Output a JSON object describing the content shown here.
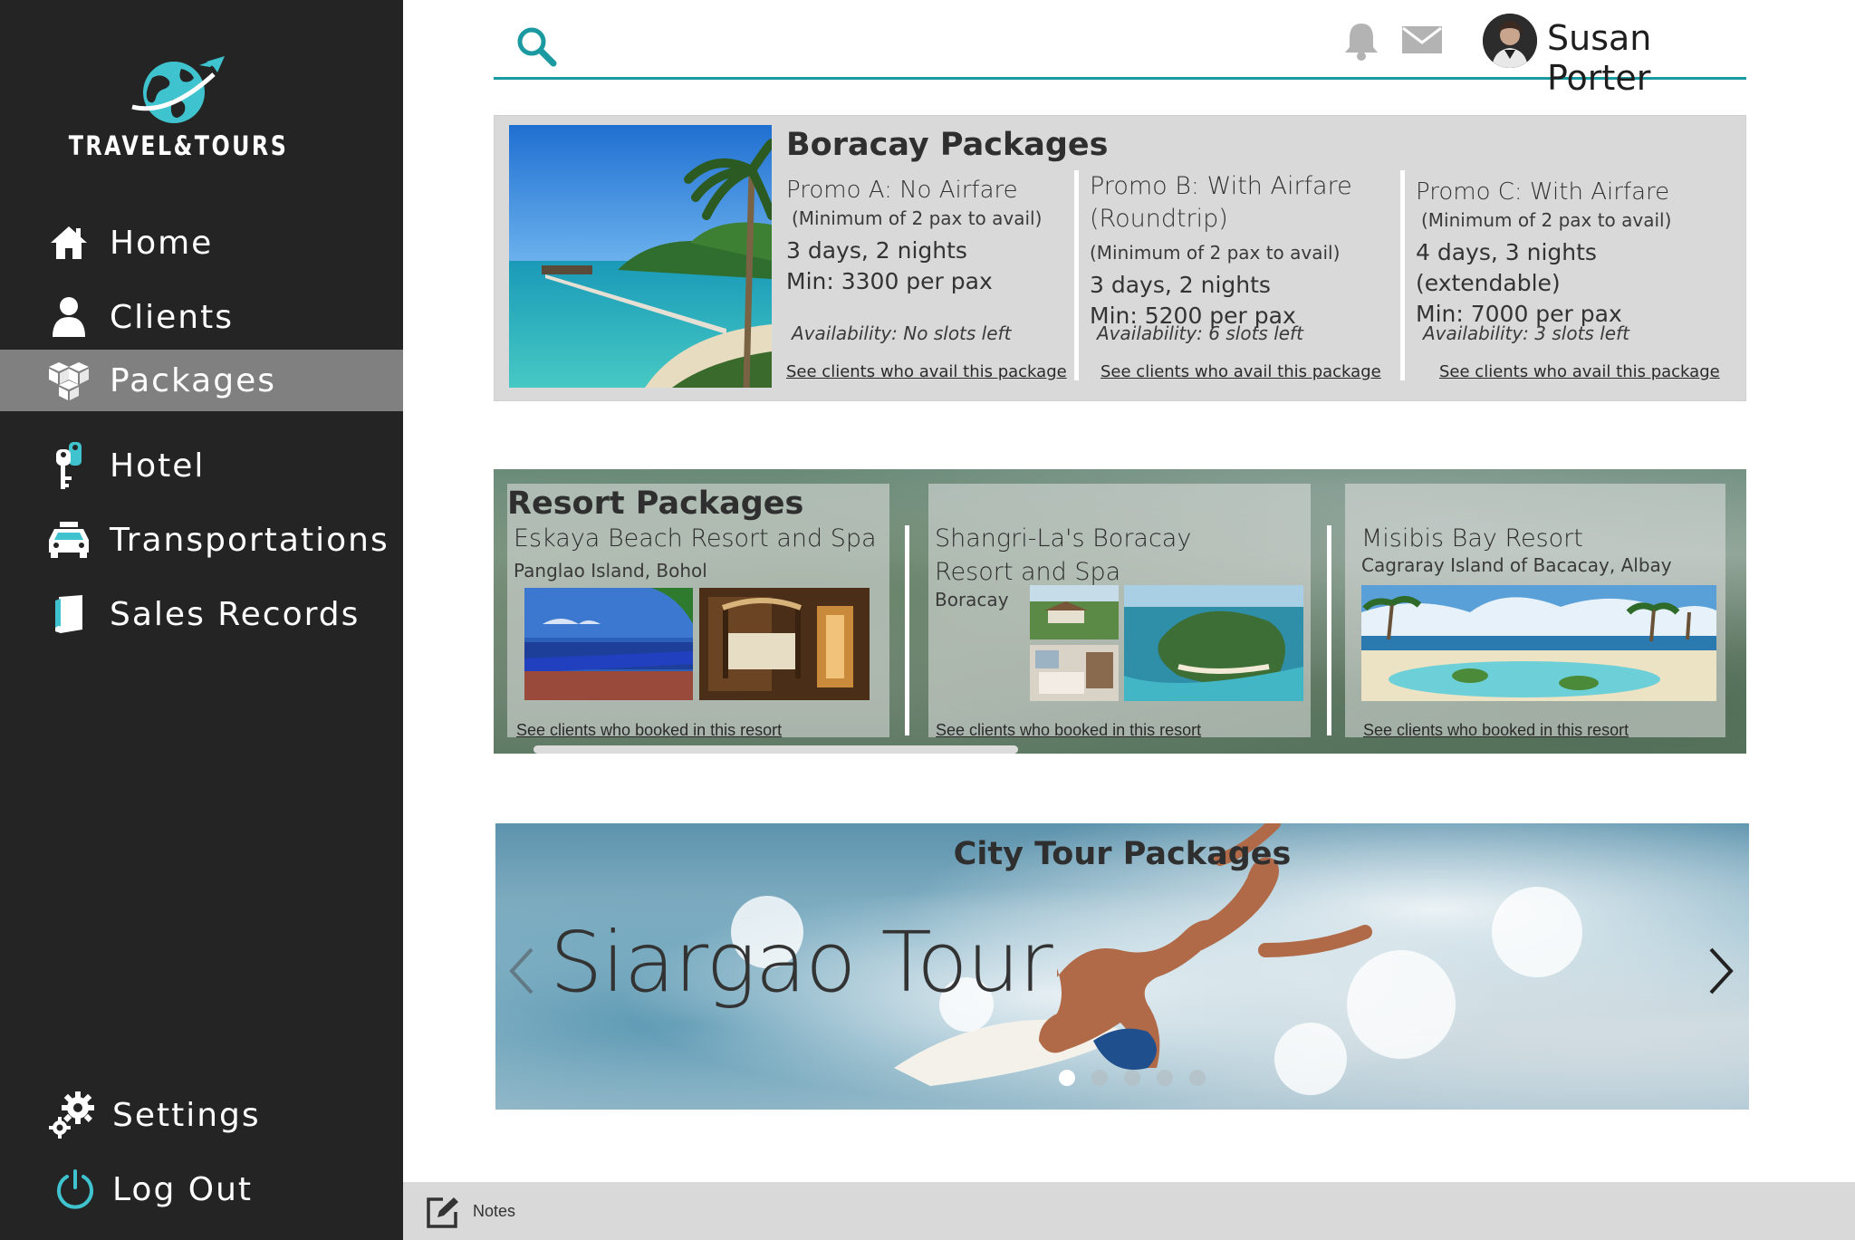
{
  "brand": {
    "name": "TRAVEL&TOURS",
    "accent": "#3fc4cf"
  },
  "sidebar": {
    "items": [
      {
        "label": "Home",
        "icon": "home-icon"
      },
      {
        "label": "Clients",
        "icon": "user-icon"
      },
      {
        "label": "Packages",
        "icon": "boxes-icon",
        "active": true
      },
      {
        "label": "Hotel",
        "icon": "hotel-key-icon"
      },
      {
        "label": "Transportations",
        "icon": "car-icon"
      },
      {
        "label": "Sales Records",
        "icon": "book-icon"
      }
    ],
    "bottom": [
      {
        "label": "Settings",
        "icon": "gears-icon"
      },
      {
        "label": "Log Out",
        "icon": "power-icon"
      }
    ]
  },
  "header": {
    "user_name": "Susan Porter"
  },
  "boracay": {
    "title": "Boracay Packages",
    "promos": [
      {
        "name": "Promo A: No Airfare",
        "min_note": "(Minimum of 2 pax to avail)",
        "duration": "3 days, 2 nights",
        "price": "Min: 3300 per pax",
        "availability": "Availability: No slots left",
        "link": "See clients who avail this package"
      },
      {
        "name": "Promo B: With Airfare (Roundtrip)",
        "min_note": "(Minimum of 2 pax to avail)",
        "duration": "3 days, 2 nights",
        "price": "Min: 5200 per pax",
        "availability": "Availability: 6 slots left",
        "link": "See clients who avail this package"
      },
      {
        "name": "Promo C: With Airfare",
        "min_note": "(Minimum of 2 pax to avail)",
        "duration": "4 days, 3 nights (extendable)",
        "price": "Min: 7000 per pax",
        "availability": "Availability: 3 slots left",
        "link": "See clients who avail this package"
      }
    ]
  },
  "resorts": {
    "title": "Resort Packages",
    "items": [
      {
        "name": "Eskaya Beach Resort and Spa",
        "location": "Panglao Island, Bohol",
        "link": "See clients who booked in this resort"
      },
      {
        "name": "Shangri-La's Boracay Resort and Spa",
        "location": "Boracay",
        "link": "See clients who booked in this resort"
      },
      {
        "name": "Misibis Bay Resort",
        "location": "Cagraray Island of Bacacay, Albay",
        "link": "See clients who booked in this resort"
      }
    ]
  },
  "city_tour": {
    "title": "City Tour Packages",
    "slide_title": "Siargao Tour",
    "slide_count": 5,
    "active_slide": 1
  },
  "footer": {
    "notes_label": "Notes"
  }
}
